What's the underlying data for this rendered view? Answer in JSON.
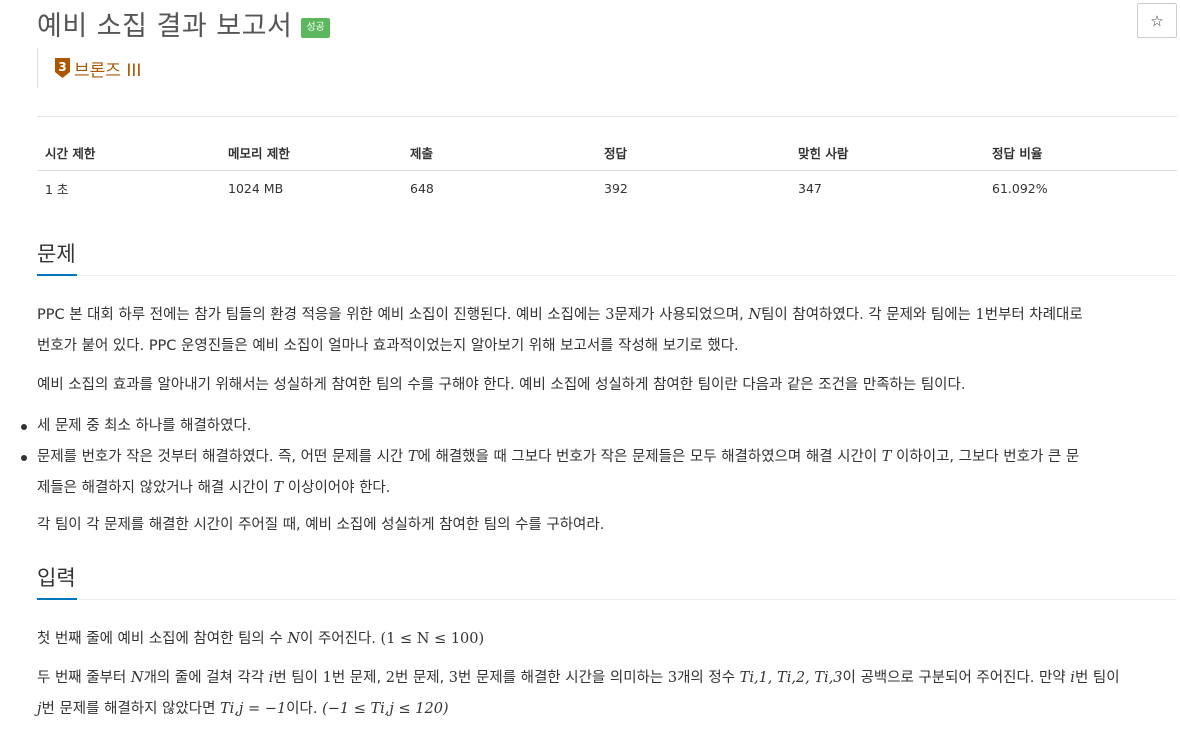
{
  "header": {
    "title": "예비 소집 결과 보고서",
    "status_badge": "성공",
    "star_icon": "star-icon",
    "star_glyph": "☆"
  },
  "tier": {
    "level_number": "3",
    "label": "브론즈 III",
    "color": "#ad5600",
    "icon": "bronze-tier-icon"
  },
  "stats": {
    "headers": [
      "시간 제한",
      "메모리 제한",
      "제출",
      "정답",
      "맞힌 사람",
      "정답 비율"
    ],
    "values": [
      "1 초",
      "1024 MB",
      "648",
      "392",
      "347",
      "61.092%"
    ]
  },
  "problem": {
    "heading": "문제",
    "p1_a": "PPC 본 대회 하루 전에는 참가 팀들의 환경 적응을 위한 예비 소집이 진행된다. 예비 소집에는 ",
    "p1_num": "3",
    "p1_b": "문제가 사용되었으며, ",
    "p1_var": "N",
    "p1_c": "팀이 참여하였다. 각 문제와 팀에는 ",
    "p1_num2": "1",
    "p1_d": "번부터 차례대로",
    "p1_e": "번호가 붙어 있다. PPC 운영진들은 예비 소집이 얼마나 효과적이었는지 알아보기 위해 보고서를 작성해 보기로 했다.",
    "p2": "예비 소집의 효과를 알아내기 위해서는 성실하게 참여한 팀의 수를 구해야 한다. 예비 소집에 성실하게 참여한 팀이란 다음과 같은 조건을 만족하는 팀이다.",
    "bullet1": "세 문제 중 최소 하나를 해결하였다.",
    "bullet2_a": "문제를 번호가 작은 것부터 해결하였다. 즉, 어떤 문제를 시간 ",
    "bullet2_var1": "T",
    "bullet2_b": "에 해결했을 때 그보다 번호가 작은 문제들은 모두 해결하였으며 해결 시간이 ",
    "bullet2_var2": "T",
    "bullet2_c": " 이하이고, 그보다 번호가 큰 문",
    "bullet2_d": "제들은 해결하지 않았거나 해결 시간이 ",
    "bullet2_var3": "T",
    "bullet2_e": " 이상이어야 한다.",
    "p3": "각 팀이 각 문제를 해결한 시간이 주어질 때, 예비 소집에 성실하게 참여한 팀의 수를 구하여라."
  },
  "input": {
    "heading": "입력",
    "l1_a": "첫 번째 줄에 예비 소집에 참여한 팀의 수 ",
    "l1_var": "N",
    "l1_b": "이 주어진다. ",
    "l1_math": "(1 ≤ N ≤ 100)",
    "l2_a": "두 번째 줄부터 ",
    "l2_var": "N",
    "l2_b": "개의 줄에 걸쳐 각각 ",
    "l2_i": "i",
    "l2_c": "번 팀이 ",
    "l2_n1": "1",
    "l2_d": "번 문제, ",
    "l2_n2": "2",
    "l2_e": "번 문제, ",
    "l2_n3": "3",
    "l2_f": "번 문제를 해결한 시간을 의미하는 ",
    "l2_n4": "3",
    "l2_g": "개의 정수 ",
    "l2_math": "Ti,1, Ti,2, Ti,3",
    "l2_h": "이 공백으로 구분되어 주어진다. 만약 ",
    "l2_i2": "i",
    "l2_j": "번 팀이",
    "l3_j": "j",
    "l3_a": "번 문제를 해결하지 않았다면 ",
    "l3_math1": "Ti,j = −1",
    "l3_b": "이다. ",
    "l3_math2": "(−1 ≤ Ti,j ≤ 120)"
  }
}
